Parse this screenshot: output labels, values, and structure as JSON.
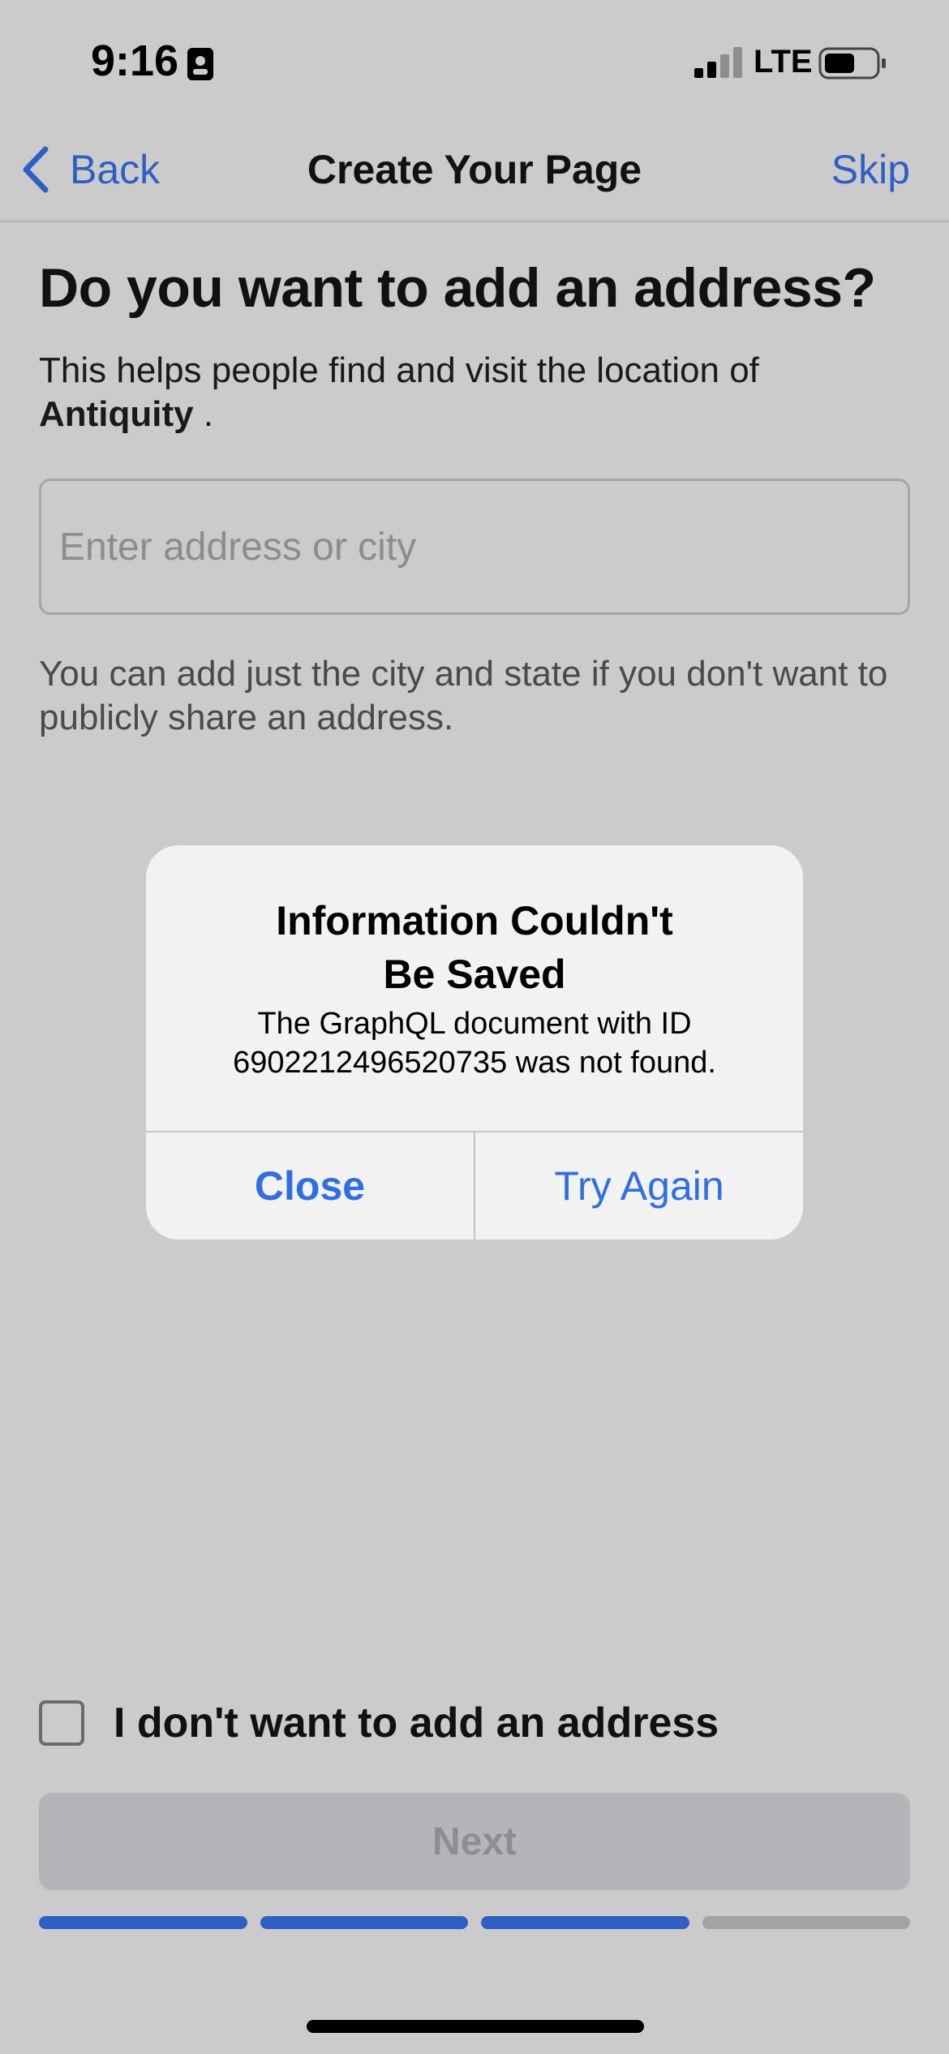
{
  "status_bar": {
    "time": "9:16",
    "network": "LTE",
    "icons": [
      "id-card-icon",
      "signal-icon",
      "battery-icon"
    ]
  },
  "nav": {
    "back_label": "Back",
    "title": "Create Your Page",
    "skip_label": "Skip"
  },
  "main": {
    "question": "Do you want to add an address?",
    "description_prefix": "This helps people find and visit the location of",
    "page_name": "Antiquity",
    "description_suffix": " .",
    "address_placeholder": "Enter address or city",
    "address_value": "",
    "helper_text": "You can add just the city and state if you don't want to publicly share an address."
  },
  "dialog": {
    "title_line1": "Information Couldn't",
    "title_line2": "Be Saved",
    "message_line1": "The GraphQL document with ID",
    "message_line2": "6902212496520735 was not found.",
    "close_label": "Close",
    "retry_label": "Try Again"
  },
  "footer": {
    "checkbox_label": "I don't want to add an address",
    "checkbox_checked": false,
    "next_label": "Next",
    "progress_completed": 3,
    "progress_total": 4
  },
  "colors": {
    "accent": "#2f5fc4",
    "progress_active": "#2f5fc4",
    "progress_inactive": "#a3a3a5",
    "background": "#cbcbcc",
    "dialog_background": "#f2f2f2"
  }
}
